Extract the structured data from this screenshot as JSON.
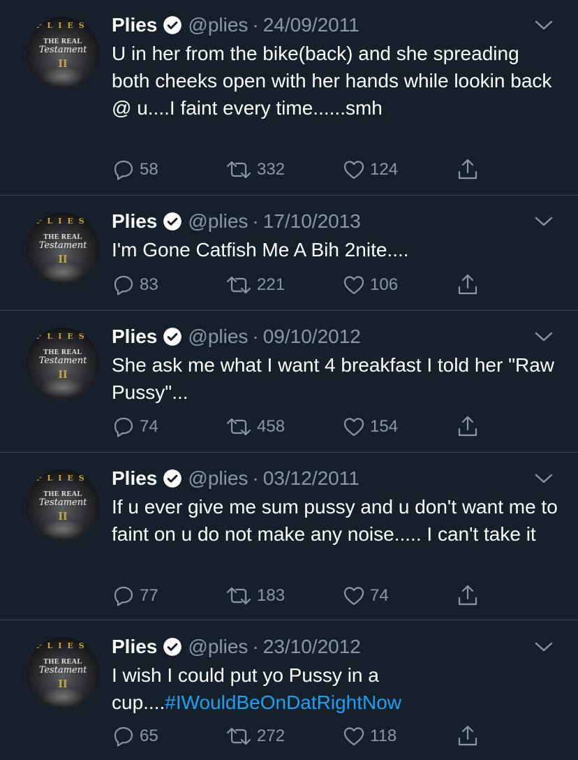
{
  "tweets": [
    {
      "name": "Plies",
      "handle": "@plies",
      "separator": "·",
      "date": "24/09/2011",
      "text": "U in her from the bike(back) and she spreading both cheeks open with her hands while lookin back @ u....I faint every time......smh",
      "hashtag": "",
      "replies": "58",
      "retweets": "332",
      "likes": "124"
    },
    {
      "name": "Plies",
      "handle": "@plies",
      "separator": "·",
      "date": "17/10/2013",
      "text": "I'm Gone Catfish Me A Bih 2nite....",
      "hashtag": "",
      "replies": "83",
      "retweets": "221",
      "likes": "106"
    },
    {
      "name": "Plies",
      "handle": "@plies",
      "separator": "·",
      "date": "09/10/2012",
      "text": "She ask me what I want 4 breakfast I told her \"Raw Pussy\"...",
      "hashtag": "",
      "replies": "74",
      "retweets": "458",
      "likes": "154"
    },
    {
      "name": "Plies",
      "handle": "@plies",
      "separator": "·",
      "date": "03/12/2011",
      "text": "If u ever give me sum pussy and u don't want me to faint on u do not make any noise..... I can't take it",
      "hashtag": "",
      "replies": "77",
      "retweets": "183",
      "likes": "74"
    },
    {
      "name": "Plies",
      "handle": "@plies",
      "separator": "·",
      "date": "23/10/2012",
      "text": "I wish I could put yo Pussy in a cup....",
      "hashtag": "#IWouldBeOnDatRightNow",
      "replies": "65",
      "retweets": "272",
      "likes": "118"
    }
  ],
  "avatar": {
    "top_text": "PLIES",
    "line1": "THE REAL",
    "line2": "Testament",
    "line3": "II"
  },
  "icons": {
    "verified": "verified-badge-icon",
    "chevron": "chevron-down-icon",
    "reply": "reply-icon",
    "retweet": "retweet-icon",
    "like": "heart-icon",
    "share": "share-icon"
  },
  "colors": {
    "background": "#15202b",
    "divider": "#38444d",
    "secondary_text": "#8899a6",
    "link": "#1da1f2"
  }
}
